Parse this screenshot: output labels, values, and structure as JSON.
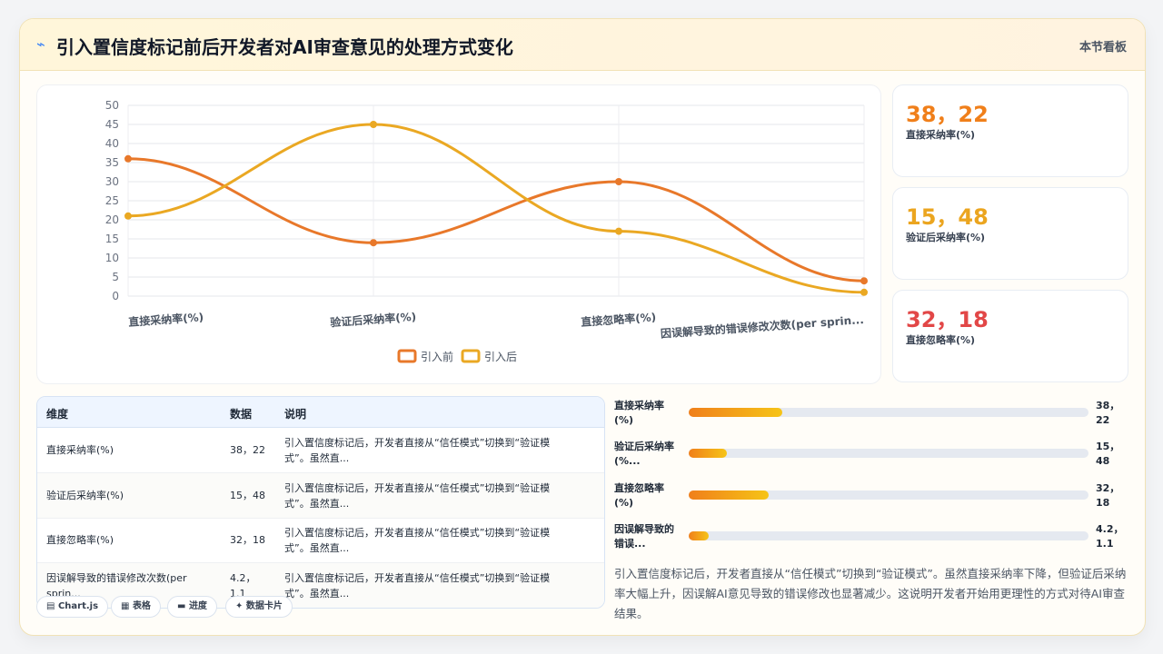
{
  "header": {
    "title": "引入置信度标记前后开发者对AI审查意见的处理方式变化",
    "link": "本节看板",
    "icon": "chart-line-icon"
  },
  "chart_data": {
    "type": "line",
    "categories": [
      "直接采纳率(%)",
      "验证后采纳率(%)",
      "直接忽略率(%)",
      "因误解导致的错误修改次数(per sprin..."
    ],
    "series": [
      {
        "name": "引入前",
        "values": [
          36,
          14,
          30,
          4
        ],
        "color": "#e8782a"
      },
      {
        "name": "引入后",
        "values": [
          21,
          45,
          17,
          1
        ],
        "color": "#eaa823"
      }
    ],
    "yticks": [
      "0",
      "5",
      "10",
      "15",
      "20",
      "25",
      "30",
      "35",
      "40",
      "45",
      "50"
    ],
    "ylim": [
      0,
      50
    ],
    "legend_position": "bottom",
    "grid": true
  },
  "stats": [
    {
      "value": "38，22",
      "label": "直接采纳率(%)",
      "color": "#f07f1a"
    },
    {
      "value": "15，48",
      "label": "验证后采纳率(%)",
      "color": "#eba51f"
    },
    {
      "value": "32，18",
      "label": "直接忽略率(%)",
      "color": "#e24747"
    }
  ],
  "table": {
    "headers": [
      "维度",
      "数据",
      "说明"
    ],
    "rows": [
      {
        "dim": "直接采纳率(%)",
        "data": "38，22",
        "desc1": "引入置信度标记后，开发者直接从“信任模式”切换到“验证模",
        "desc2": "式”。虽然直..."
      },
      {
        "dim": "验证后采纳率(%)",
        "data": "15，48",
        "desc1": "引入置信度标记后，开发者直接从“信任模式”切换到“验证模",
        "desc2": "式”。虽然直..."
      },
      {
        "dim": "直接忽略率(%)",
        "data": "32，18",
        "desc1": "引入置信度标记后，开发者直接从“信任模式”切换到“验证模",
        "desc2": "式”。虽然直..."
      },
      {
        "dim1": "因误解导致的错误修改次数(per",
        "dim2": "sprin...",
        "data1": "4.2，",
        "data2": "1.1",
        "desc1": "引入置信度标记后，开发者直接从“信任模式”切换到“验证模",
        "desc2": "式”。虽然直..."
      }
    ]
  },
  "tabs": [
    {
      "label": "Chart.js",
      "icon": "chart-icon"
    },
    {
      "label": "表格",
      "icon": "table-icon"
    },
    {
      "label": "进度",
      "icon": "progress-icon"
    },
    {
      "label": "数据卡片",
      "icon": "card-icon"
    }
  ],
  "bars": [
    {
      "label1": "直接采纳率",
      "label2": "(%)",
      "v1": "38，",
      "v2": "22",
      "pct": 23.5
    },
    {
      "label1": "验证后采纳率",
      "label2": "(%...",
      "v1": "15，",
      "v2": "48",
      "pct": 9.5
    },
    {
      "label1": "直接忽略率",
      "label2": "(%)",
      "v1": "32，",
      "v2": "18",
      "pct": 20
    },
    {
      "label1": "因误解导致的",
      "label2": "错误...",
      "v1": "4.2，",
      "v2": "1.1",
      "pct": 5
    }
  ],
  "summary": "引入置信度标记后，开发者直接从“信任模式”切换到“验证模式”。虽然直接采纳率下降，但验证后采纳率大幅上升，因误解AI意见导致的错误修改也显著减少。这说明开发者开始用更理性的方式对待AI审查结果。"
}
